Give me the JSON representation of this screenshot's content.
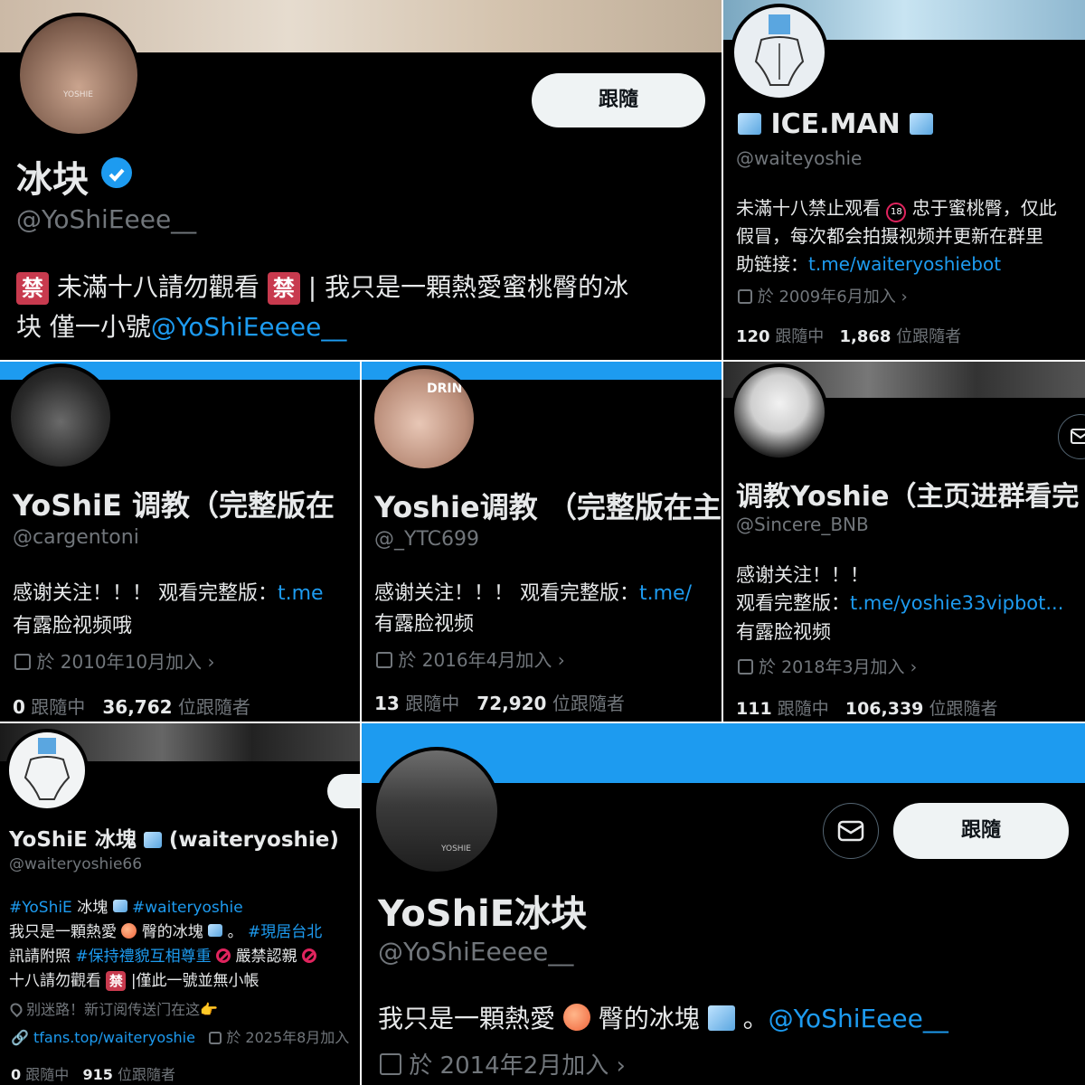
{
  "p1": {
    "follow": "跟隨",
    "name": "冰块",
    "handle": "@YoShiEeee__",
    "bio_a": "未滿十八請勿觀看",
    "bio_b": "| 我只是一顆熱愛蜜桃臀的冰",
    "bio_c": "块 僅一小號",
    "bio_link": "@YoShiEeeee__",
    "ban_glyph": "禁",
    "avatar_text": "YOSHIE"
  },
  "p2": {
    "name": "ICE.MAN",
    "handle": "@waiteyoshie",
    "bio_1": "未滿十八禁止观看",
    "bio_1b": "忠于蜜桃臀，仅此",
    "bio_2": "假冒，每次都会拍摄视频并更新在群里",
    "bio_3": "助链接：",
    "bio_link": "t.me/waiteryoshiebot",
    "joined": "於 2009年6月加入",
    "following_count": "120",
    "following_label": "跟隨中",
    "followers_count": "1,868",
    "followers_label": "位跟隨者"
  },
  "p3": {
    "name": "YoShiE 调教（完整版在",
    "handle": "@cargentoni",
    "bio_1": "感谢关注！！！ 观看完整版：",
    "bio_link": "t.me",
    "bio_2": "有露脸视频哦",
    "joined": "於 2010年10月加入",
    "following_count": "0",
    "following_label": "跟隨中",
    "followers_count": "36,762",
    "followers_label": "位跟隨者"
  },
  "p4": {
    "name": "Yoshie调教 （完整版在主",
    "handle": "@_YTC699",
    "bio_1": "感谢关注！！！ 观看完整版：",
    "bio_link": "t.me/",
    "bio_2": "有露脸视频",
    "joined": "於 2016年4月加入",
    "following_count": "13",
    "following_label": "跟隨中",
    "followers_count": "72,920",
    "followers_label": "位跟隨者",
    "avatar_text": "DRIN"
  },
  "p5": {
    "name": "调教Yoshie（主页进群看完",
    "handle": "@Sincere_BNB",
    "bio_1": "感谢关注！！！",
    "bio_2": "观看完整版：",
    "bio_link": "t.me/yoshie33vipbot...",
    "bio_3": "有露脸视频",
    "joined": "於 2018年3月加入",
    "following_count": "111",
    "following_label": "跟隨中",
    "followers_count": "106,339",
    "followers_label": "位跟隨者"
  },
  "p6": {
    "name": "YoShiE 冰塊",
    "name_b": "(waiteryoshie)",
    "handle": "@waiteryoshie66",
    "tag_1": "#YoShiE",
    "bio_1b": "冰塊",
    "tag_2": "#waiteryoshie",
    "bio_2a": "我只是一顆熱愛",
    "bio_2b": "臀的冰塊",
    "bio_2c": "。",
    "tag_3": "#現居台北",
    "bio_3a": "訊請附照",
    "tag_4": "#保持禮貌互相尊重",
    "bio_3b": "嚴禁認親",
    "bio_4a": "十八請勿觀看",
    "bio_4b": "|僅此一號並無小帳",
    "location": "别迷路！新订阅传送门在这👉",
    "website": "tfans.top/waiteryoshie",
    "joined": "於 2025年8月加入",
    "following_count": "0",
    "following_label": "跟隨中",
    "followers_count": "915",
    "followers_label": "位跟隨者",
    "ban_glyph": "禁"
  },
  "p7": {
    "follow": "跟隨",
    "name": "YoShiE冰块",
    "handle": "@YoShiEeeee__",
    "bio_a": "我只是一顆熱愛",
    "bio_b": "臀的冰塊",
    "bio_c": "。",
    "bio_link": "@YoShiEeee__",
    "joined": "於 2014年2月加入",
    "avatar_text": "YOSHIE"
  },
  "colors": {
    "background": "#000000",
    "text": "#e7e9ea",
    "secondary": "#71767b",
    "link": "#1d9bf0",
    "verified": "#1d9bf0",
    "banner_blue": "#1d9bf0"
  },
  "icons": [
    "verified-badge-icon",
    "calendar-icon",
    "chevron-right-icon",
    "mail-icon",
    "location-icon",
    "link-icon",
    "ice-cube-emoji",
    "peach-emoji",
    "prohibited-emoji",
    "under-18-emoji"
  ]
}
